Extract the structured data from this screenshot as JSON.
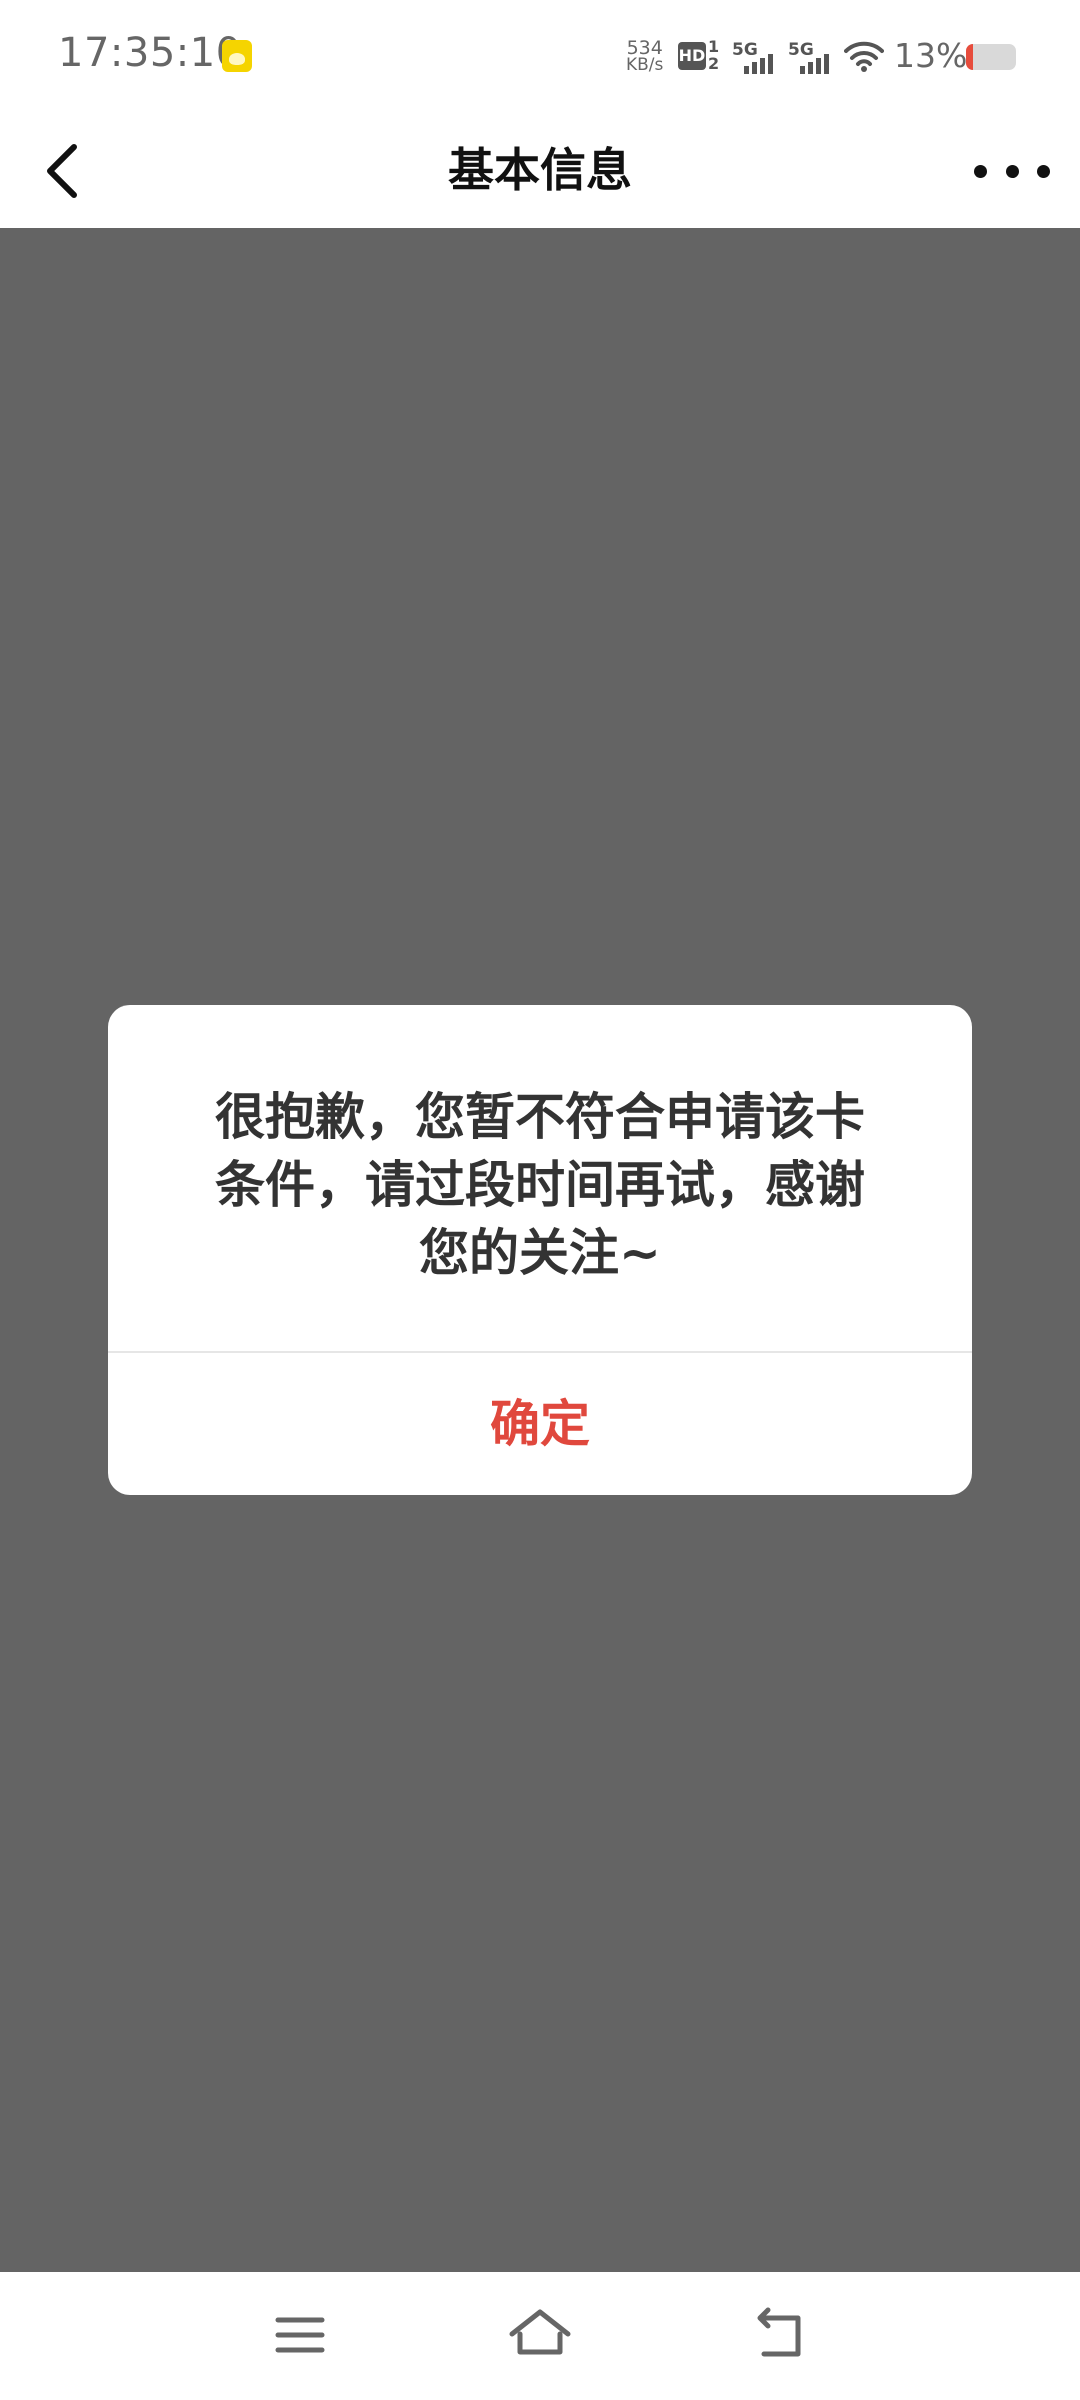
{
  "status_bar": {
    "time": "17:35:10",
    "net_speed_value": "534",
    "net_speed_unit": "KB/s",
    "hd_label": "HD",
    "hd_sub": "1\n2",
    "signal_1": "5G",
    "signal_2": "5G",
    "battery_percent": "13%",
    "battery_level": 0.13,
    "battery_color": "#e74c3c"
  },
  "nav": {
    "title": "基本信息",
    "back_icon": "chevron-left-icon",
    "more_icon": "more-horizontal-icon"
  },
  "overlay_color": "#646464",
  "dialog": {
    "message": "很抱歉，您暂不符合申请该卡条件，请过段时间再试，感谢您的关注~",
    "confirm_label": "确定",
    "confirm_color": "#e0483d"
  },
  "system_nav": {
    "menu_icon": "menu-icon",
    "home_icon": "home-icon",
    "back_icon": "return-icon"
  }
}
